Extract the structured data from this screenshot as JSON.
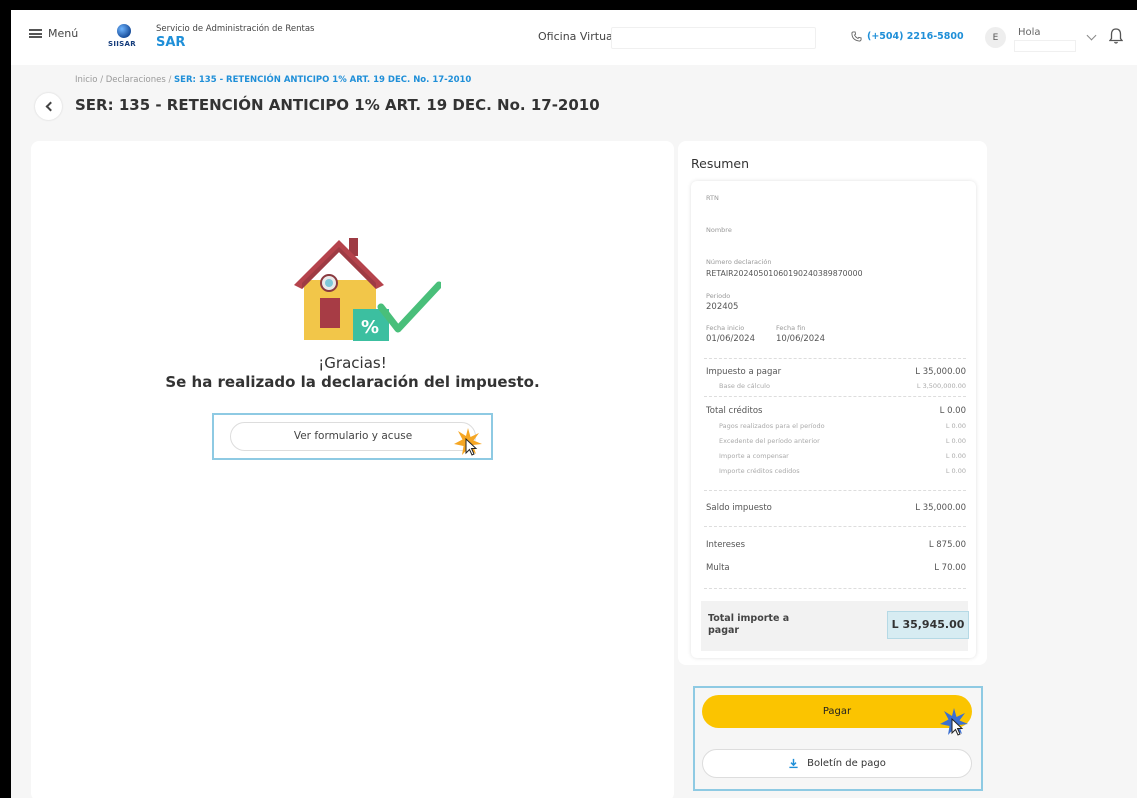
{
  "topbar": {
    "menu_label": "Menú",
    "logo_text": "SIISAR",
    "brand_subtitle": "Servicio de Administración de Rentas",
    "brand_name": "SAR",
    "office_label": "Oficina Virtual",
    "phone": "(+504) 2216-5800",
    "avatar_initial": "E",
    "greeting": "Hola"
  },
  "breadcrumb": {
    "prefix": "Inicio / Declaraciones / ",
    "current": "SER: 135 - RETENCIÓN ANTICIPO 1% ART. 19 DEC. No. 17-2010"
  },
  "page": {
    "title": "SER: 135 - RETENCIÓN ANTICIPO 1% ART. 19 DEC. No. 17-2010"
  },
  "confirmation": {
    "thanks": "¡Gracias!",
    "message": "Se ha realizado la declaración del impuesto.",
    "form_button": "Ver formulario y acuse"
  },
  "summary": {
    "title": "Resumen",
    "rtn_label": "RTN",
    "name_label": "Nombre",
    "decl_number_label": "Número declaración",
    "decl_number": "RETAIR20240501060190240389870000",
    "period_label": "Periodo",
    "period": "202405",
    "start_label": "Fecha inicio",
    "start": "01/06/2024",
    "end_label": "Fecha fin",
    "end": "10/06/2024",
    "tax_label": "Impuesto a pagar",
    "tax_value": "L 35,000.00",
    "base_label": "Base de cálculo",
    "base_value": "L 3,500,000.00",
    "credits_label": "Total créditos",
    "credits_value": "L 0.00",
    "credit_items": [
      {
        "label": "Pagos realizados para el período",
        "value": "L 0.00"
      },
      {
        "label": "Excedente del período anterior",
        "value": "L 0.00"
      },
      {
        "label": "Importe a compensar",
        "value": "L 0.00"
      },
      {
        "label": "Importe créditos cedidos",
        "value": "L 0.00"
      }
    ],
    "balance_label": "Saldo impuesto",
    "balance_value": "L 35,000.00",
    "interest_label": "Intereses",
    "interest_value": "L 875.00",
    "fine_label": "Multa",
    "fine_value": "L 70.00",
    "total_label": "Total importe a pagar",
    "total_value": "L 35,945.00"
  },
  "actions": {
    "pay_button": "Pagar",
    "slip_button": "Boletín de pago"
  },
  "colors": {
    "accent": "#1f8fd8",
    "pay_button": "#fbc400",
    "highlight": "#8ecae3",
    "total_box": "#d7ecf2"
  },
  "icons": [
    "menu-icon",
    "phone-icon",
    "chevron-down-icon",
    "bell-icon",
    "back-arrow-icon",
    "house-check-icon",
    "click-cursor-icon",
    "download-icon"
  ]
}
